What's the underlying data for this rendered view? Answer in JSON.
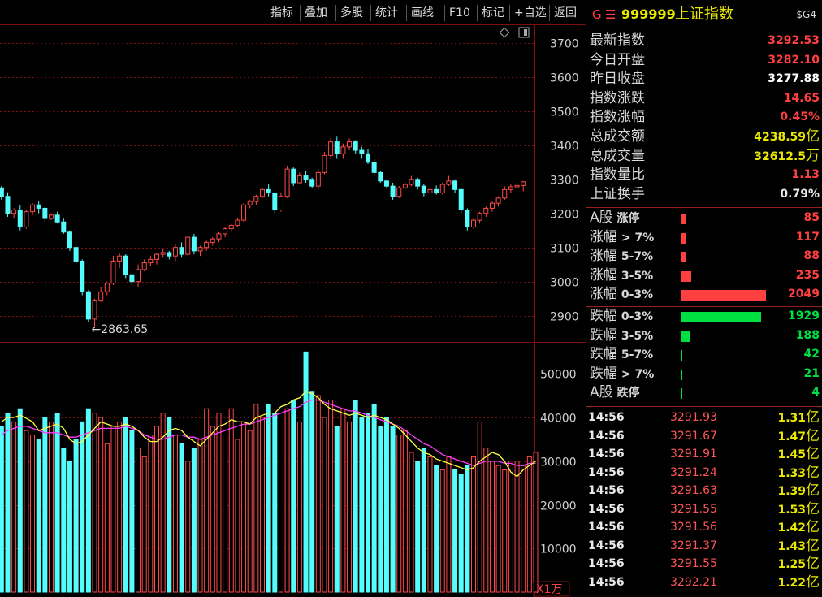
{
  "toolbar": {
    "items": [
      "指标",
      "叠加",
      "多股",
      "统计",
      "画线",
      "F10",
      "标记",
      "+自选",
      "返回"
    ]
  },
  "quote": {
    "prefix": "G",
    "menu_glyph": "☰",
    "code": "999999",
    "name": "上证指数",
    "badge": "$G4"
  },
  "stats": [
    {
      "label": "最新指数",
      "value": "3292.53",
      "color": "#ff4040"
    },
    {
      "label": "今日开盘",
      "value": "3282.10",
      "color": "#ff4040"
    },
    {
      "label": "昨日收盘",
      "value": "3277.88",
      "color": "#ffffff"
    },
    {
      "label": "指数涨跌",
      "value": "14.65",
      "color": "#ff4040"
    },
    {
      "label": "指数涨幅",
      "value": "0.45%",
      "color": "#ff4040"
    },
    {
      "label": "总成交额",
      "value": "4238.59",
      "unit": "亿",
      "color": "#e8e800"
    },
    {
      "label": "总成交量",
      "value": "32612.5",
      "unit": "万",
      "color": "#e8e800"
    },
    {
      "label": "指数量比",
      "value": "1.13",
      "color": "#ff4040"
    },
    {
      "label": "上证换手",
      "value": "0.79%",
      "color": "#e8e8e8"
    }
  ],
  "breadth": [
    {
      "l1": "A股",
      "l2": " 涨停",
      "value": "85",
      "count": 85,
      "color": "#ff4040",
      "bar": "#ff4040"
    },
    {
      "l1": "涨幅",
      "l2": " > 7%",
      "value": "117",
      "count": 117,
      "color": "#ff4040",
      "bar": "#ff4040"
    },
    {
      "l1": "涨幅",
      "l2": " 5-7%",
      "value": "88",
      "count": 88,
      "color": "#ff4040",
      "bar": "#ff4040"
    },
    {
      "l1": "涨幅",
      "l2": " 3-5%",
      "value": "235",
      "count": 235,
      "color": "#ff4040",
      "bar": "#ff4040"
    },
    {
      "l1": "涨幅",
      "l2": " 0-3%",
      "value": "2049",
      "count": 2049,
      "color": "#ff4040",
      "bar": "#ff4040"
    },
    {
      "l1": "跌幅",
      "l2": " 0-3%",
      "value": "1929",
      "count": 1929,
      "color": "#00e040",
      "bar": "#00e040"
    },
    {
      "l1": "跌幅",
      "l2": " 3-5%",
      "value": "188",
      "count": 188,
      "color": "#00e040",
      "bar": "#00e040"
    },
    {
      "l1": "跌幅",
      "l2": " 5-7%",
      "value": "42",
      "count": 42,
      "color": "#00e040",
      "bar": "#00e040"
    },
    {
      "l1": "跌幅",
      "l2": " > 7%",
      "value": "21",
      "count": 21,
      "color": "#00e040",
      "bar": "#00e040"
    },
    {
      "l1": "A股",
      "l2": " 跌停",
      "value": "4",
      "count": 4,
      "color": "#00e040",
      "bar": "#00e040"
    }
  ],
  "ticks": [
    {
      "time": "14:56",
      "price": "3291.93",
      "vol": "1.31",
      "unit": "亿"
    },
    {
      "time": "14:56",
      "price": "3291.67",
      "vol": "1.47",
      "unit": "亿"
    },
    {
      "time": "14:56",
      "price": "3291.91",
      "vol": "1.45",
      "unit": "亿"
    },
    {
      "time": "14:56",
      "price": "3291.24",
      "vol": "1.33",
      "unit": "亿"
    },
    {
      "time": "14:56",
      "price": "3291.63",
      "vol": "1.39",
      "unit": "亿"
    },
    {
      "time": "14:56",
      "price": "3291.55",
      "vol": "1.53",
      "unit": "亿"
    },
    {
      "time": "14:56",
      "price": "3291.56",
      "vol": "1.42",
      "unit": "亿"
    },
    {
      "time": "14:56",
      "price": "3291.37",
      "vol": "1.43",
      "unit": "亿"
    },
    {
      "time": "14:56",
      "price": "3291.55",
      "vol": "1.25",
      "unit": "亿"
    },
    {
      "time": "14:56",
      "price": "3292.21",
      "vol": "1.22",
      "unit": "亿"
    }
  ],
  "chart_data": [
    {
      "type": "candlestick",
      "price_ticks": [
        2900,
        3000,
        3100,
        3200,
        3300,
        3400,
        3500,
        3600,
        3700
      ],
      "ylim": [
        2830,
        3745
      ],
      "low_annotation": "2863.65",
      "low_value": 2863.65,
      "colors": {
        "up": "#ff4a4a",
        "down": "#54fcfc",
        "grid": "#7a1010"
      },
      "series": [
        {
          "name": "daily",
          "values": [
            [
              3275,
              3280,
              3240,
              3250
            ],
            [
              3250,
              3262,
              3190,
              3200
            ],
            [
              3200,
              3215,
              3185,
              3210
            ],
            [
              3210,
              3225,
              3150,
              3160
            ],
            [
              3160,
              3210,
              3155,
              3205
            ],
            [
              3205,
              3230,
              3195,
              3225
            ],
            [
              3225,
              3235,
              3200,
              3215
            ],
            [
              3215,
              3218,
              3175,
              3185
            ],
            [
              3185,
              3200,
              3180,
              3195
            ],
            [
              3195,
              3205,
              3170,
              3175
            ],
            [
              3175,
              3185,
              3140,
              3145
            ],
            [
              3145,
              3150,
              3090,
              3100
            ],
            [
              3100,
              3110,
              3050,
              3060
            ],
            [
              3060,
              3065,
              2960,
              2970
            ],
            [
              2970,
              2975,
              2880,
              2890
            ],
            [
              2890,
              2950,
              2864,
              2945
            ],
            [
              2945,
              2985,
              2940,
              2970
            ],
            [
              2970,
              3000,
              2960,
              2995
            ],
            [
              2995,
              3075,
              2990,
              3060
            ],
            [
              3060,
              3085,
              3040,
              3075
            ],
            [
              3075,
              3080,
              3010,
              3020
            ],
            [
              3020,
              3025,
              2990,
              3000
            ],
            [
              3000,
              3050,
              2985,
              3035
            ],
            [
              3035,
              3065,
              3030,
              3055
            ],
            [
              3055,
              3075,
              3045,
              3065
            ],
            [
              3065,
              3085,
              3050,
              3080
            ],
            [
              3080,
              3095,
              3070,
              3085
            ],
            [
              3085,
              3090,
              3065,
              3075
            ],
            [
              3075,
              3110,
              3060,
              3100
            ],
            [
              3100,
              3115,
              3070,
              3080
            ],
            [
              3080,
              3135,
              3075,
              3130
            ],
            [
              3130,
              3140,
              3080,
              3090
            ],
            [
              3090,
              3105,
              3075,
              3100
            ],
            [
              3100,
              3120,
              3090,
              3115
            ],
            [
              3115,
              3130,
              3105,
              3125
            ],
            [
              3125,
              3145,
              3115,
              3140
            ],
            [
              3140,
              3160,
              3130,
              3155
            ],
            [
              3155,
              3170,
              3145,
              3165
            ],
            [
              3165,
              3185,
              3160,
              3180
            ],
            [
              3180,
              3230,
              3175,
              3225
            ],
            [
              3225,
              3240,
              3215,
              3235
            ],
            [
              3235,
              3255,
              3225,
              3250
            ],
            [
              3250,
              3275,
              3245,
              3270
            ],
            [
              3270,
              3285,
              3250,
              3260
            ],
            [
              3260,
              3265,
              3200,
              3210
            ],
            [
              3210,
              3260,
              3205,
              3250
            ],
            [
              3250,
              3340,
              3245,
              3330
            ],
            [
              3330,
              3335,
              3280,
              3290
            ],
            [
              3290,
              3320,
              3285,
              3310
            ],
            [
              3310,
              3325,
              3290,
              3300
            ],
            [
              3300,
              3305,
              3275,
              3280
            ],
            [
              3280,
              3330,
              3270,
              3320
            ],
            [
              3320,
              3380,
              3315,
              3370
            ],
            [
              3370,
              3420,
              3360,
              3410
            ],
            [
              3410,
              3425,
              3360,
              3375
            ],
            [
              3375,
              3405,
              3360,
              3395
            ],
            [
              3395,
              3420,
              3385,
              3410
            ],
            [
              3410,
              3415,
              3375,
              3385
            ],
            [
              3385,
              3395,
              3360,
              3375
            ],
            [
              3375,
              3390,
              3345,
              3350
            ],
            [
              3350,
              3360,
              3310,
              3320
            ],
            [
              3320,
              3325,
              3290,
              3295
            ],
            [
              3295,
              3300,
              3275,
              3280
            ],
            [
              3280,
              3290,
              3240,
              3250
            ],
            [
              3250,
              3280,
              3245,
              3275
            ],
            [
              3275,
              3290,
              3270,
              3285
            ],
            [
              3285,
              3310,
              3280,
              3300
            ],
            [
              3300,
              3305,
              3270,
              3280
            ],
            [
              3280,
              3285,
              3250,
              3260
            ],
            [
              3260,
              3275,
              3250,
              3270
            ],
            [
              3270,
              3282,
              3255,
              3260
            ],
            [
              3260,
              3290,
              3255,
              3285
            ],
            [
              3285,
              3310,
              3280,
              3295
            ],
            [
              3295,
              3300,
              3260,
              3270
            ],
            [
              3270,
              3275,
              3200,
              3210
            ],
            [
              3210,
              3215,
              3150,
              3160
            ],
            [
              3160,
              3185,
              3155,
              3180
            ],
            [
              3180,
              3205,
              3170,
              3200
            ],
            [
              3200,
              3220,
              3190,
              3215
            ],
            [
              3215,
              3235,
              3205,
              3230
            ],
            [
              3230,
              3250,
              3220,
              3245
            ],
            [
              3245,
              3280,
              3240,
              3270
            ],
            [
              3270,
              3285,
              3260,
              3278
            ],
            [
              3278,
              3288,
              3265,
              3282
            ],
            [
              3282,
              3295,
              3265,
              3292.53
            ]
          ]
        }
      ]
    },
    {
      "type": "bar",
      "volume_ticks": [
        10000,
        20000,
        30000,
        40000,
        50000
      ],
      "ylim": [
        0,
        56000
      ],
      "unit_label": "X1万",
      "series": [
        {
          "name": "volume",
          "values": [
            38000,
            41000,
            39000,
            42000,
            37000,
            36000,
            35000,
            40000,
            39000,
            41000,
            33000,
            30000,
            35000,
            39000,
            42000,
            41000,
            40000,
            34000,
            38000,
            39000,
            40000,
            37000,
            33000,
            31000,
            36000,
            38000,
            41000,
            40000,
            36000,
            34000,
            30000,
            33000,
            35000,
            42000,
            38000,
            41000,
            36000,
            42000,
            35000,
            39000,
            37000,
            43000,
            40000,
            43000,
            41000,
            44000,
            42000,
            44000,
            39000,
            55000,
            46000,
            45000,
            40000,
            44000,
            38000,
            42000,
            39000,
            44000,
            40000,
            41000,
            43000,
            38000,
            40000,
            38000,
            36000,
            37000,
            32000,
            30000,
            33000,
            31000,
            29000,
            28000,
            31000,
            28000,
            27000,
            29000,
            31000,
            39000,
            33000,
            30000,
            29000,
            28000,
            30000,
            30000,
            29000,
            31000,
            32000
          ]
        },
        {
          "name": "MA5",
          "values": [
            39000,
            40000,
            40000,
            40500,
            39800,
            39000,
            37000,
            37500,
            38000,
            38500,
            37500,
            35000,
            34000,
            34500,
            36000,
            37500,
            39000,
            38500,
            38000,
            38000,
            38500,
            38000,
            37000,
            35500,
            34500,
            34500,
            35500,
            37000,
            37500,
            37000,
            35500,
            34500,
            33500,
            35000,
            36500,
            38000,
            38500,
            39500,
            39000,
            39000,
            38500,
            40000,
            40500,
            41000,
            41000,
            42500,
            43000,
            44000,
            44500,
            46000,
            45500,
            44500,
            43000,
            42000,
            41500,
            41000,
            40500,
            41000,
            40500,
            40000,
            40500,
            40000,
            39500,
            38500,
            37500,
            36000,
            34500,
            33000,
            32000,
            31500,
            30500,
            30000,
            29500,
            29000,
            28500,
            28000,
            28500,
            30000,
            31000,
            32000,
            31500,
            30000,
            27500,
            26500,
            28000,
            29000,
            30000
          ]
        },
        {
          "name": "MA10",
          "values": [
            36000,
            37000,
            37500,
            38000,
            38000,
            37500,
            37000,
            36500,
            36500,
            36500,
            36000,
            35500,
            35500,
            36000,
            36500,
            37000,
            37500,
            37500,
            37500,
            37500,
            38000,
            37500,
            37000,
            36000,
            35500,
            35000,
            35000,
            35500,
            36000,
            36000,
            35500,
            35500,
            35000,
            35500,
            36000,
            36500,
            37000,
            37500,
            38000,
            38500,
            38500,
            39000,
            39500,
            40000,
            40500,
            41000,
            41500,
            42000,
            42500,
            43500,
            44000,
            44000,
            43500,
            43000,
            42500,
            42000,
            41500,
            41500,
            41000,
            40500,
            40000,
            39500,
            39000,
            38500,
            38000,
            37000,
            36000,
            35000,
            34000,
            33500,
            32500,
            31500,
            31000,
            30500,
            30000,
            29500,
            29000,
            29500,
            30000,
            30000,
            30000,
            29500,
            29500,
            29000,
            29000,
            29500,
            29500
          ]
        }
      ]
    }
  ]
}
